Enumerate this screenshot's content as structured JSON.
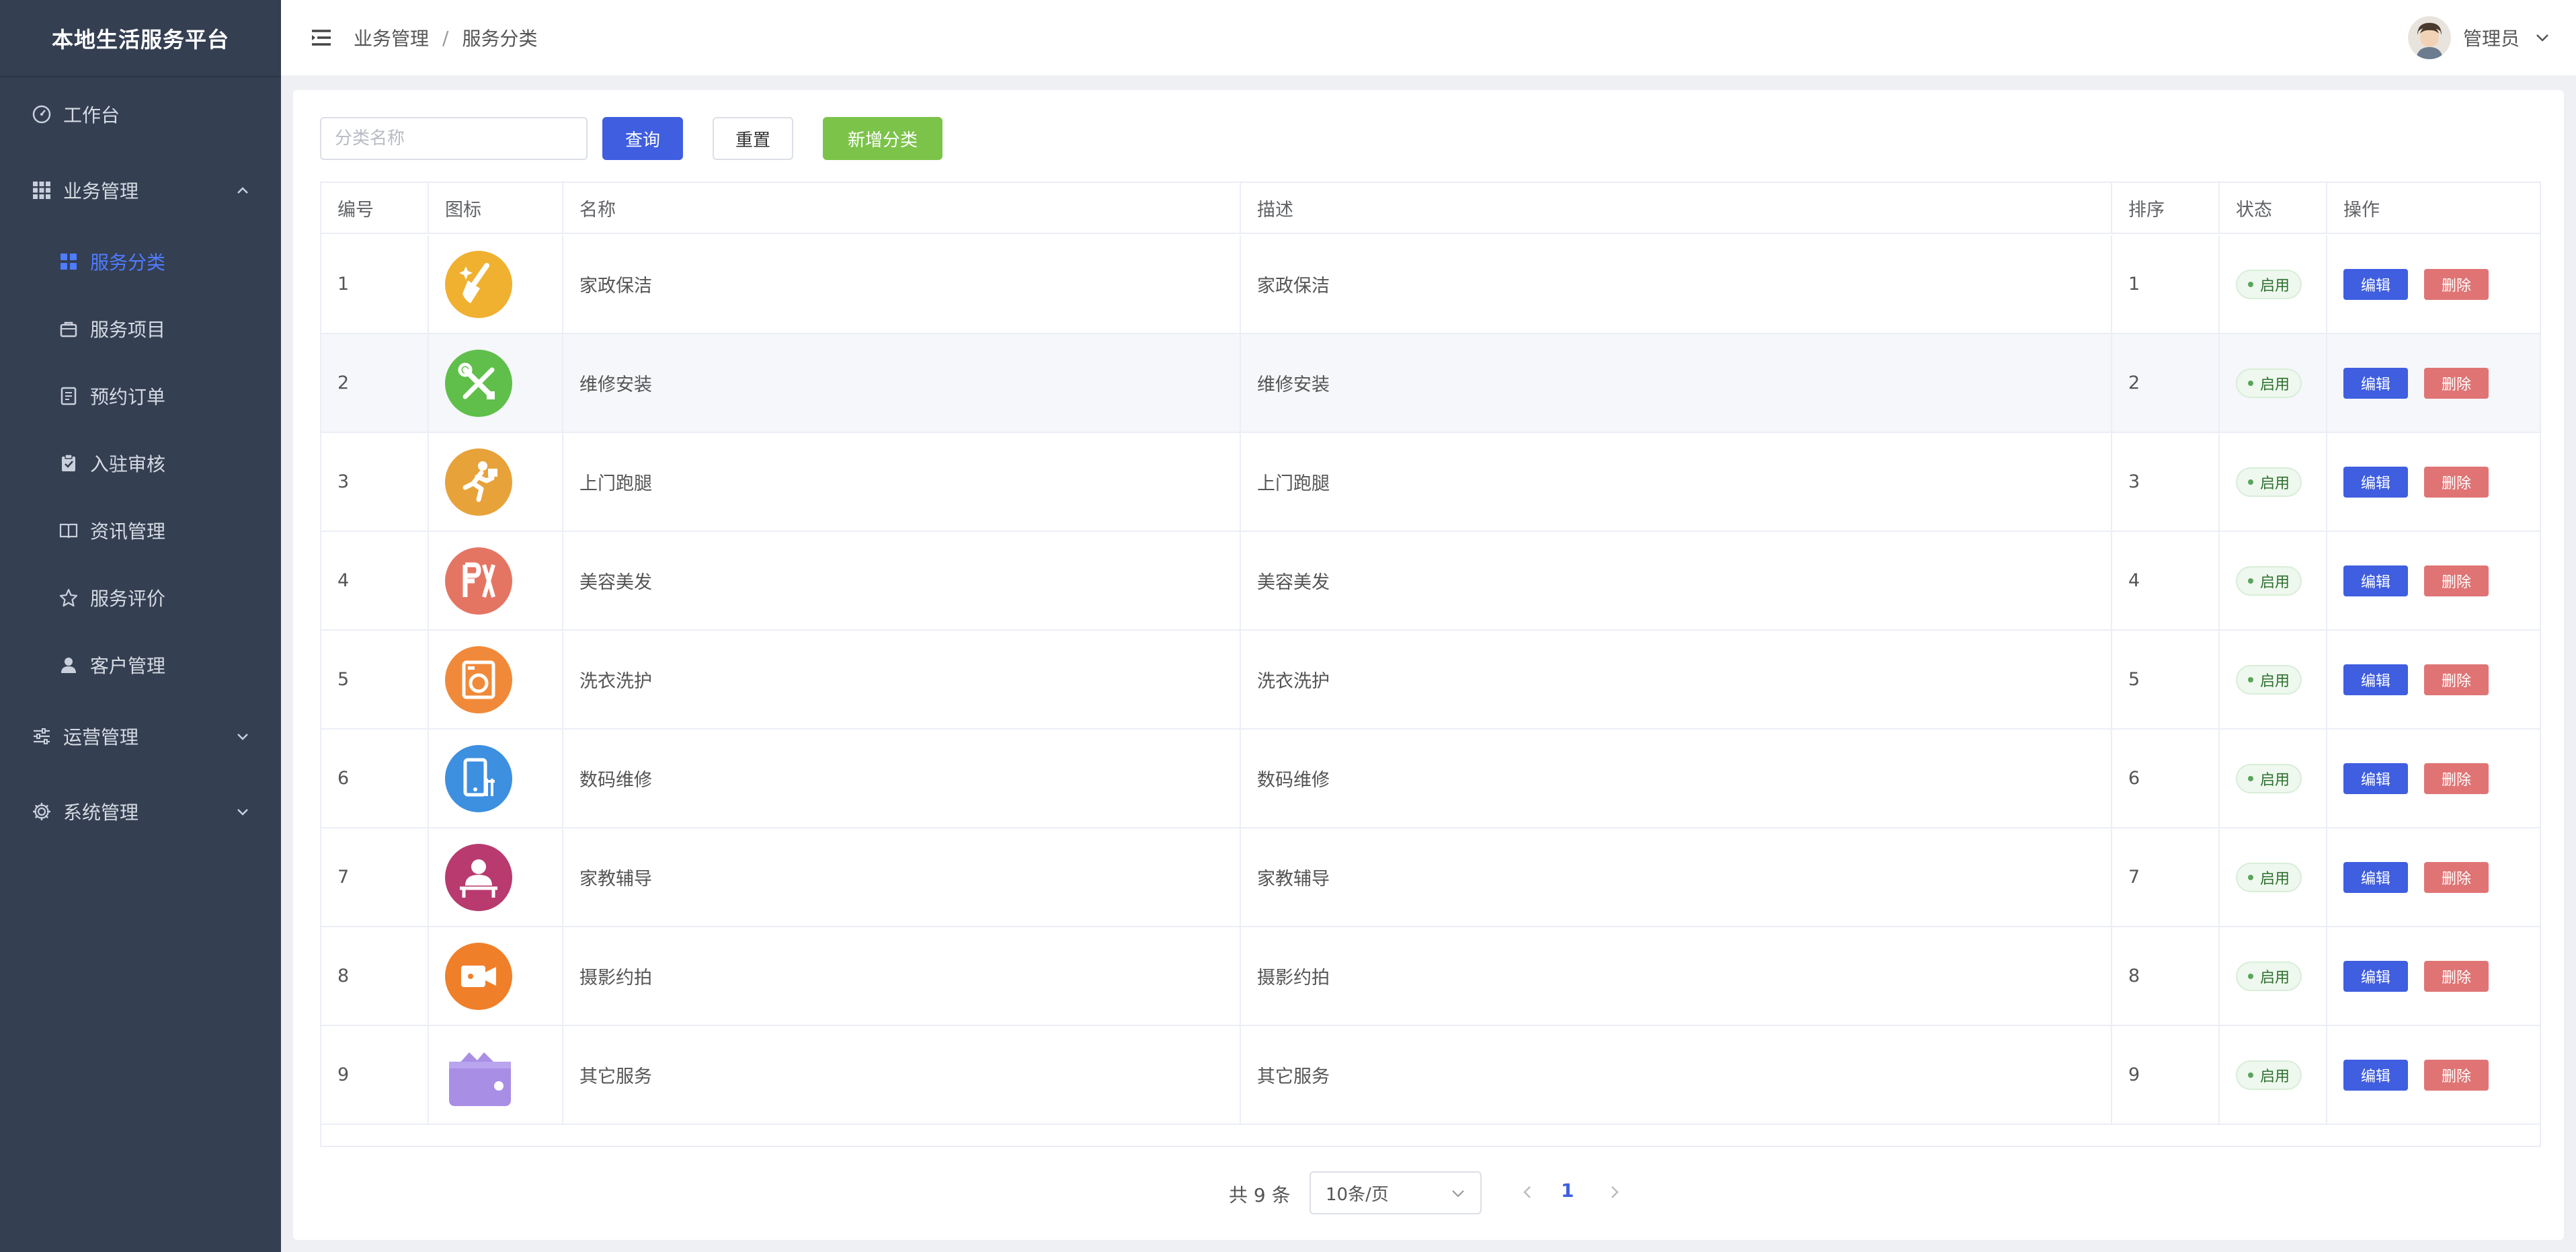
{
  "app": {
    "title": "本地生活服务平台"
  },
  "sidebar": {
    "items": [
      {
        "label": "工作台",
        "icon": "dashboard-icon"
      },
      {
        "label": "业务管理",
        "icon": "grid-icon"
      },
      {
        "label": "服务分类",
        "icon": "category-icon"
      },
      {
        "label": "服务项目",
        "icon": "bag-icon"
      },
      {
        "label": "预约订单",
        "icon": "document-icon"
      },
      {
        "label": "入驻审核",
        "icon": "clipboard-icon"
      },
      {
        "label": "资讯管理",
        "icon": "book-icon"
      },
      {
        "label": "服务评价",
        "icon": "star-icon"
      },
      {
        "label": "客户管理",
        "icon": "user-icon"
      },
      {
        "label": "运营管理",
        "icon": "sliders-icon"
      },
      {
        "label": "系统管理",
        "icon": "gear-icon"
      }
    ]
  },
  "header": {
    "breadcrumb": [
      "业务管理",
      "服务分类"
    ],
    "separator": "/",
    "user_name": "管理员"
  },
  "toolbar": {
    "search_placeholder": "分类名称",
    "query_label": "查询",
    "reset_label": "重置",
    "add_label": "新增分类"
  },
  "table": {
    "columns": [
      "编号",
      "图标",
      "名称",
      "描述",
      "排序",
      "状态",
      "操作"
    ],
    "rows": [
      {
        "id": "1",
        "name": "家政保洁",
        "desc": "家政保洁",
        "sort": "1",
        "status": "启用",
        "icon": "broom-icon",
        "color": "#f0b030"
      },
      {
        "id": "2",
        "name": "维修安装",
        "desc": "维修安装",
        "sort": "2",
        "status": "启用",
        "icon": "tools-icon",
        "color": "#5fbf4a"
      },
      {
        "id": "3",
        "name": "上门跑腿",
        "desc": "上门跑腿",
        "sort": "3",
        "status": "启用",
        "icon": "runner-icon",
        "color": "#e8a23a"
      },
      {
        "id": "4",
        "name": "美容美发",
        "desc": "美容美发",
        "sort": "4",
        "status": "启用",
        "icon": "scissors-comb-icon",
        "color": "#e57563"
      },
      {
        "id": "5",
        "name": "洗衣洗护",
        "desc": "洗衣洗护",
        "sort": "5",
        "status": "启用",
        "icon": "washing-machine-icon",
        "color": "#f08a3a"
      },
      {
        "id": "6",
        "name": "数码维修",
        "desc": "数码维修",
        "sort": "6",
        "status": "启用",
        "icon": "phone-repair-icon",
        "color": "#3d8fe0"
      },
      {
        "id": "7",
        "name": "家教辅导",
        "desc": "家教辅导",
        "sort": "7",
        "status": "启用",
        "icon": "tutor-icon",
        "color": "#b83a6e"
      },
      {
        "id": "8",
        "name": "摄影约拍",
        "desc": "摄影约拍",
        "sort": "8",
        "status": "启用",
        "icon": "camera-icon",
        "color": "#f07f2a"
      },
      {
        "id": "9",
        "name": "其它服务",
        "desc": "其它服务",
        "sort": "9",
        "status": "启用",
        "icon": "wallet-icon",
        "color": "#a98ee6"
      }
    ],
    "edit_label": "编辑",
    "delete_label": "删除"
  },
  "pagination": {
    "total_text": "共 9 条",
    "page_size": "10条/页",
    "current_page": "1"
  },
  "colors": {
    "sidebar_bg": "#343f52",
    "primary": "#3f5ee0",
    "success": "#7cc34a",
    "danger": "#e07474",
    "active_menu": "#4f7cff"
  }
}
